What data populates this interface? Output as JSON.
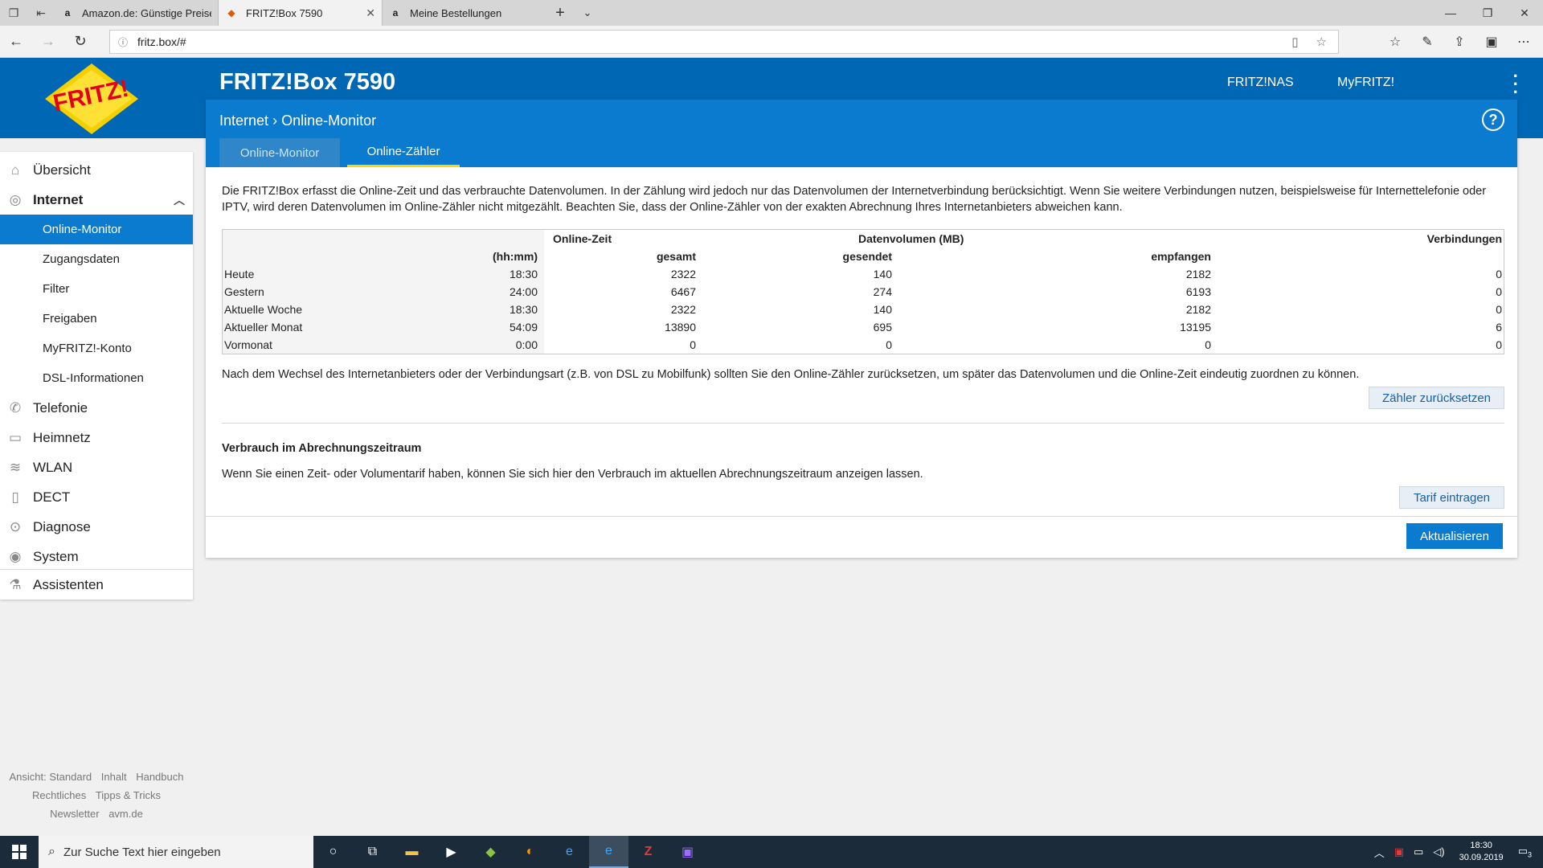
{
  "browser": {
    "tabs": [
      {
        "title": "Amazon.de: Günstige Preise",
        "favicon": "amazon-icon",
        "active": false
      },
      {
        "title": "FRITZ!Box 7590",
        "favicon": "fritz-icon",
        "active": true
      },
      {
        "title": "Meine Bestellungen",
        "favicon": "amazon-icon",
        "active": false
      }
    ],
    "url": "fritz.box/#"
  },
  "header": {
    "logo_text": "FRITZ!",
    "title": "FRITZ!Box 7590",
    "links": [
      "FRITZ!NAS",
      "MyFRITZ!"
    ]
  },
  "breadcrumb": {
    "section": "Internet",
    "page": "Online-Monitor"
  },
  "subtabs": [
    "Online-Monitor",
    "Online-Zähler"
  ],
  "sidebar": {
    "items": [
      {
        "label": "Übersicht",
        "icon": "home-icon"
      },
      {
        "label": "Internet",
        "icon": "globe-icon"
      },
      {
        "label": "Online-Monitor"
      },
      {
        "label": "Zugangsdaten"
      },
      {
        "label": "Filter"
      },
      {
        "label": "Freigaben"
      },
      {
        "label": "MyFRITZ!-Konto"
      },
      {
        "label": "DSL-Informationen"
      },
      {
        "label": "Telefonie",
        "icon": "phone-icon"
      },
      {
        "label": "Heimnetz",
        "icon": "network-icon"
      },
      {
        "label": "WLAN",
        "icon": "wifi-icon"
      },
      {
        "label": "DECT",
        "icon": "dect-icon"
      },
      {
        "label": "Diagnose",
        "icon": "diagnose-icon"
      },
      {
        "label": "System",
        "icon": "system-icon"
      },
      {
        "label": "Assistenten",
        "icon": "wizard-icon"
      }
    ],
    "footer": {
      "line1": [
        "Ansicht: Standard",
        "Inhalt",
        "Handbuch"
      ],
      "line2": [
        "Rechtliches",
        "Tipps & Tricks"
      ],
      "line3": [
        "Newsletter",
        "avm.de"
      ]
    }
  },
  "content": {
    "intro": "Die FRITZ!Box erfasst die Online-Zeit und das verbrauchte Datenvolumen. In der Zählung wird jedoch nur das Datenvolumen der Internetverbindung berücksichtigt. Wenn Sie weitere Verbindungen nutzen, beispielsweise für Internettelefonie oder IPTV, wird deren Datenvolumen im Online-Zähler nicht mitgezählt. Beachten Sie, dass der Online-Zähler von der exakten Abrechnung Ihres Internetanbieters abweichen kann.",
    "table": {
      "header1": [
        "Online-Zeit",
        "Datenvolumen (MB)",
        "Verbindungen"
      ],
      "header2": [
        "(hh:mm)",
        "gesamt",
        "gesendet",
        "empfangen"
      ],
      "rows": [
        {
          "label": "Heute",
          "time": "18:30",
          "total": "2322",
          "sent": "140",
          "received": "2182",
          "connections": "0"
        },
        {
          "label": "Gestern",
          "time": "24:00",
          "total": "6467",
          "sent": "274",
          "received": "6193",
          "connections": "0"
        },
        {
          "label": "Aktuelle Woche",
          "time": "18:30",
          "total": "2322",
          "sent": "140",
          "received": "2182",
          "connections": "0"
        },
        {
          "label": "Aktueller Monat",
          "time": "54:09",
          "total": "13890",
          "sent": "695",
          "received": "13195",
          "connections": "6"
        },
        {
          "label": "Vormonat",
          "time": "0:00",
          "total": "0",
          "sent": "0",
          "received": "0",
          "connections": "0"
        }
      ]
    },
    "note": "Nach dem Wechsel des Internetanbieters oder der Verbindungsart (z.B. von DSL zu Mobilfunk) sollten Sie den Online-Zähler zurücksetzen, um später das Datenvolumen und die Online-Zeit eindeutig zuordnen zu können.",
    "reset_button": "Zähler zurücksetzen",
    "billing_heading": "Verbrauch im Abrechnungszeitraum",
    "billing_text": "Wenn Sie einen Zeit- oder Volumentarif haben, können Sie sich hier den Verbrauch im aktuellen Abrechnungszeitraum anzeigen lassen.",
    "tariff_button": "Tarif eintragen",
    "refresh_button": "Aktualisieren"
  },
  "taskbar": {
    "search_placeholder": "Zur Suche Text hier eingeben",
    "time": "18:30",
    "date": "30.09.2019",
    "notifications": "3"
  }
}
